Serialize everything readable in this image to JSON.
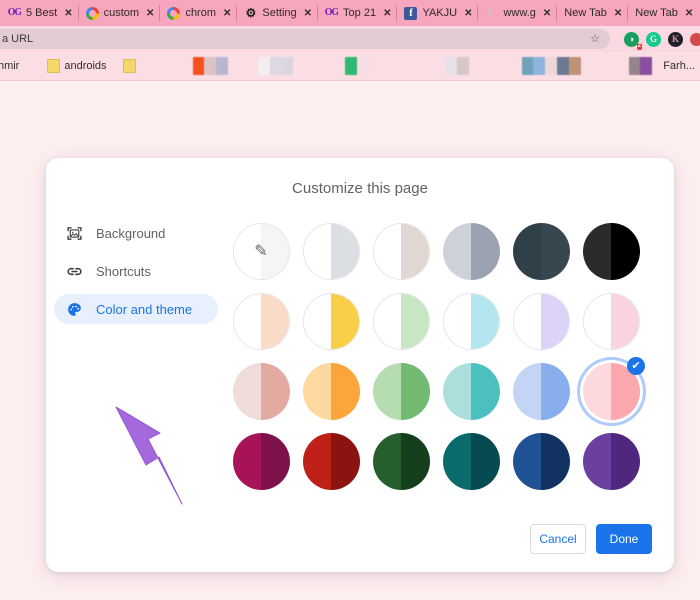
{
  "browser": {
    "tabs": [
      {
        "title": "5 Best",
        "favicon": "og-icon",
        "close": "✕"
      },
      {
        "title": "custom",
        "favicon": "google-icon",
        "close": "✕"
      },
      {
        "title": "chrom",
        "favicon": "google-icon",
        "close": "✕"
      },
      {
        "title": "Setting",
        "favicon": "gear-icon",
        "close": "✕"
      },
      {
        "title": "Top 21",
        "favicon": "og-icon",
        "close": "✕"
      },
      {
        "title": "YAKJU",
        "favicon": "facebook-icon",
        "close": "✕"
      },
      {
        "title": "www.g",
        "favicon": "moon-icon",
        "close": "✕"
      },
      {
        "title": "New Tab",
        "favicon": "none",
        "close": "✕"
      },
      {
        "title": "New Tab",
        "favicon": "none",
        "close": "✕"
      }
    ],
    "omnibox": {
      "value": "a URL",
      "placeholder": "Search Google or type a URL",
      "star_icon": "☆"
    },
    "toolbar_icons": [
      {
        "name": "extension-icon",
        "glyph": "◗",
        "badge": "2",
        "color": "#1a9e5e"
      },
      {
        "name": "grammarly-icon",
        "glyph": "G",
        "color": "#16c98d"
      },
      {
        "name": "kaspersky-icon",
        "glyph": "K",
        "color": "#1f1f2e"
      },
      {
        "name": "profile-avatar",
        "glyph": "",
        "color": "#d44a4a"
      }
    ],
    "bookmarks": [
      {
        "type": "label",
        "label": "Kashmir"
      },
      {
        "type": "folder",
        "label": "androids"
      },
      {
        "type": "folder",
        "label": ""
      },
      {
        "type": "blur",
        "colors": [
          "#f4511e",
          "#dcc3c6",
          "#b9b6cf"
        ]
      },
      {
        "type": "blur",
        "colors": [
          "#f2eef1",
          "#dcd8e4",
          "#dbd5e0"
        ]
      },
      {
        "type": "blur",
        "colors": [
          "#2eb872",
          "#f6dfe2"
        ]
      },
      {
        "type": "blur",
        "colors": [
          "#e5e0ea",
          "#d9c7c8"
        ]
      },
      {
        "type": "blur",
        "colors": [
          "#6ea2bd",
          "#8fb4dd",
          "#eed7d6"
        ]
      },
      {
        "type": "blur",
        "colors": [
          "#6d7a94",
          "#c09279"
        ]
      },
      {
        "type": "blur",
        "colors": [
          "#96848a",
          "#8a4fa0"
        ]
      },
      {
        "type": "label",
        "label": "Farh..."
      }
    ]
  },
  "dialog": {
    "title": "Customize this page",
    "sidebar": [
      {
        "label": "Background",
        "icon": "image-icon",
        "active": false
      },
      {
        "label": "Shortcuts",
        "icon": "link-icon",
        "active": false
      },
      {
        "label": "Color and theme",
        "icon": "palette-icon",
        "active": true
      }
    ],
    "theme_grid": {
      "selected_index": 17,
      "check_glyph": "✔",
      "swatches": [
        {
          "name": "custom-color-picker",
          "left": "#ffffff",
          "right": "#f5f5f5",
          "outline": true,
          "icon": "eyedropper-icon",
          "icon_glyph": "✎"
        },
        {
          "name": "theme-grey-light",
          "left": "#ffffff",
          "right": "#dbdee3",
          "outline": true
        },
        {
          "name": "theme-beige",
          "left": "#ffffff",
          "right": "#e0d7d2",
          "outline": true
        },
        {
          "name": "theme-grey",
          "left": "#ced1d8",
          "right": "#9ba3b2",
          "outline": false
        },
        {
          "name": "theme-dark-slate",
          "left": "#2f4048",
          "right": "#37474f",
          "outline": false
        },
        {
          "name": "theme-black",
          "left": "#2b2b2b",
          "right": "#000000",
          "outline": false
        },
        {
          "name": "theme-peach-light",
          "left": "#ffffff",
          "right": "#fadbc8",
          "outline": true
        },
        {
          "name": "theme-yellow",
          "left": "#ffffff",
          "right": "#fcd council",
          "outline": true
        },
        {
          "name": "theme-green-light",
          "left": "#ffffff",
          "right": "#c7e6c3",
          "outline": true
        },
        {
          "name": "theme-cyan-light",
          "left": "#ffffff",
          "right": "#b3e6ef",
          "outline": true
        },
        {
          "name": "theme-lavender-light",
          "left": "#ffffff",
          "right": "#ddd2f7",
          "outline": true
        },
        {
          "name": "theme-pink-light",
          "left": "#ffffff",
          "right": "#f9d3e0",
          "outline": true
        },
        {
          "name": "theme-rose",
          "left": "#f0dcd8",
          "right": "#e2aaa1",
          "outline": false
        },
        {
          "name": "theme-orange",
          "left": "#fdd9a0",
          "right": "#fba53a",
          "outline": false
        },
        {
          "name": "theme-green",
          "left": "#b6ddb2",
          "right": "#72b972",
          "outline": false
        },
        {
          "name": "theme-teal",
          "left": "#abdfdc",
          "right": "#4cbfbf",
          "outline": false
        },
        {
          "name": "theme-blue-light",
          "left": "#c3d4f5",
          "right": "#89aeee",
          "outline": false
        },
        {
          "name": "theme-pink",
          "left": "#fdd9de",
          "right": "#fba8ae",
          "outline": false
        },
        {
          "name": "theme-magenta-dark",
          "left": "#a81257",
          "right": "#7d114a",
          "outline": false
        },
        {
          "name": "theme-red-dark",
          "left": "#bf2119",
          "right": "#8c1410",
          "outline": false
        },
        {
          "name": "theme-forest-dark",
          "left": "#255f2e",
          "right": "#153f1c",
          "outline": false
        },
        {
          "name": "theme-teal-dark",
          "left": "#0b6a6b",
          "right": "#054b4f",
          "outline": false
        },
        {
          "name": "theme-navy",
          "left": "#1f5294",
          "right": "#123262",
          "outline": false
        },
        {
          "name": "theme-purple-dark",
          "left": "#6a3fa0",
          "right": "#50277e",
          "outline": false
        }
      ]
    },
    "footer": {
      "cancel_label": "Cancel",
      "done_label": "Done"
    }
  },
  "annotation": {
    "arrow_color": "#a569dd"
  }
}
